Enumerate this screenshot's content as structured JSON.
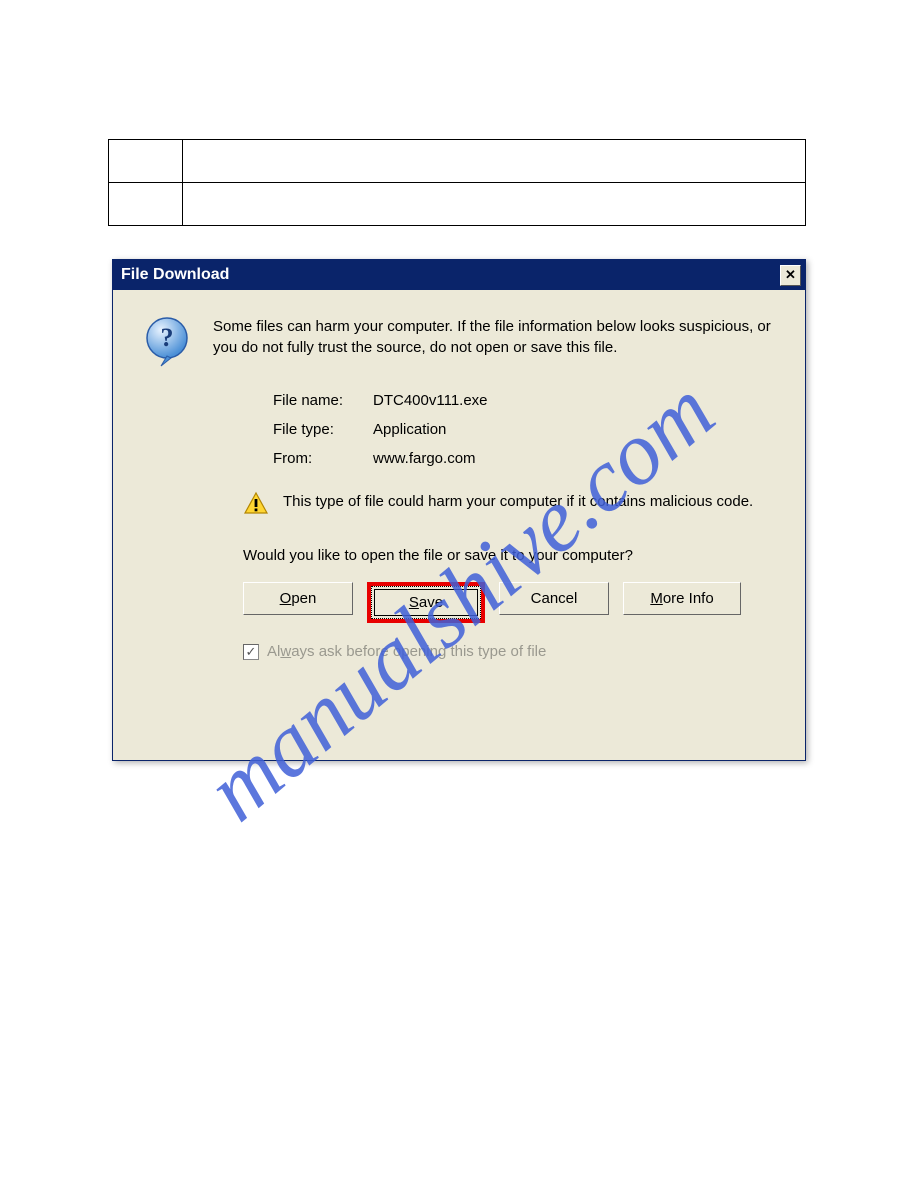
{
  "dialog": {
    "title": "File Download",
    "message": "Some files can harm your computer. If the file information below looks suspicious, or you do not fully trust the source, do not open or save this file.",
    "file_name_label": "File name:",
    "file_name_value": "DTC400v111.exe",
    "file_type_label": "File type:",
    "file_type_value": "Application",
    "from_label": "From:",
    "from_value": "www.fargo.com",
    "warning": "This type of file could harm your computer if it contains malicious code.",
    "prompt": "Would you like to open the file or save it to your computer?",
    "buttons": {
      "open_pre": "O",
      "open_rest": "pen",
      "save_pre": "S",
      "save_rest": "ave",
      "cancel": "Cancel",
      "more_pre": "M",
      "more_rest": "ore Info"
    },
    "checkbox_pre": "Al",
    "checkbox_ul": "w",
    "checkbox_rest": "ays ask before opening this type of file"
  },
  "watermark": "manualshive.com"
}
